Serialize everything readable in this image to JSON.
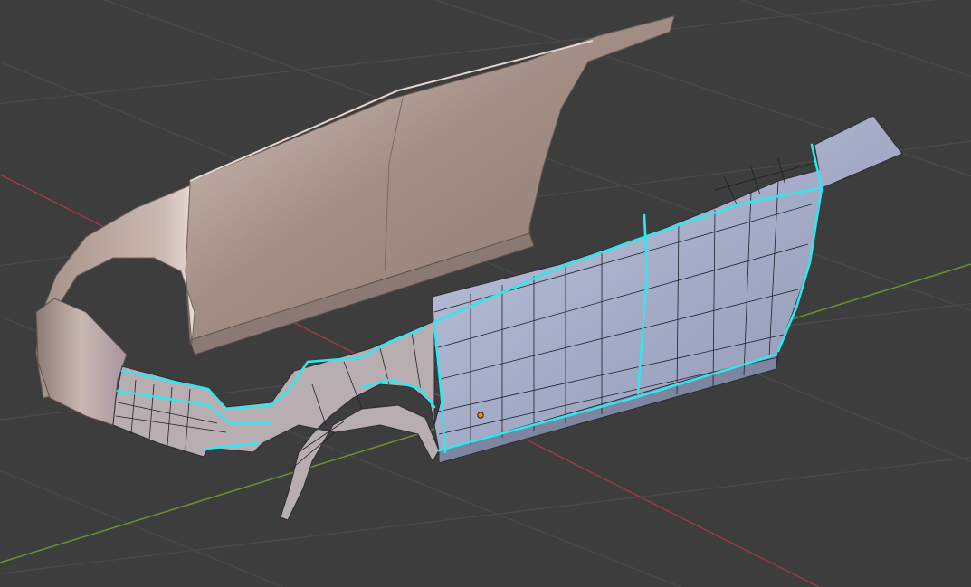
{
  "app": "3D Viewport",
  "colors": {
    "background": "#3d3d3d",
    "grid_line": "#4a4a4a",
    "x_axis": "#9b3b46",
    "y_axis": "#6c9130",
    "reference_mesh": "#b29a8f",
    "edited_mesh": "#a3abc6",
    "selected_edge": "#33e6ee",
    "mesh_wire": "#1e2028",
    "origin_point": "#f08a1e"
  },
  "icons": {
    "object_origin": "origin-dot-icon"
  }
}
